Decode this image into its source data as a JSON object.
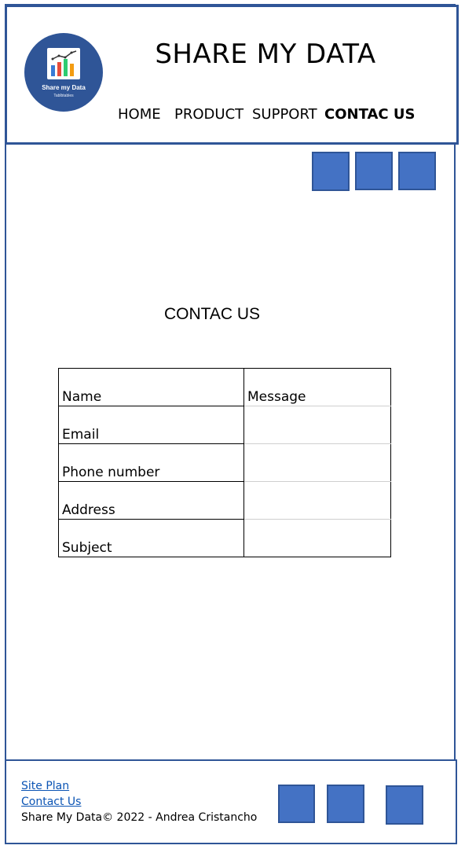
{
  "header": {
    "logo": {
      "name": "Share my Data",
      "tagline": "Tablbtables"
    },
    "title": "SHARE MY DATA",
    "nav": [
      {
        "label": "HOME",
        "active": false
      },
      {
        "label": "PRODUCT",
        "active": false
      },
      {
        "label": "SUPPORT",
        "active": false
      },
      {
        "label": "CONTAC US",
        "active": true
      }
    ]
  },
  "social_top": [
    "square-icon",
    "square-icon",
    "square-icon"
  ],
  "main": {
    "heading": "CONTAC US",
    "form": {
      "fields": [
        "Name",
        "Email",
        "Phone number",
        "Address",
        "Subject"
      ],
      "message_label": "Message"
    }
  },
  "footer": {
    "links": [
      "Site Plan",
      "Contact Us"
    ],
    "copyright": "Share My Data© 2022 - Andrea Cristancho"
  },
  "social_bottom": [
    "square-icon",
    "square-icon",
    "square-icon"
  ],
  "colors": {
    "accent": "#2f5597",
    "square_fill": "#4472c4",
    "link": "#0b54b4"
  }
}
